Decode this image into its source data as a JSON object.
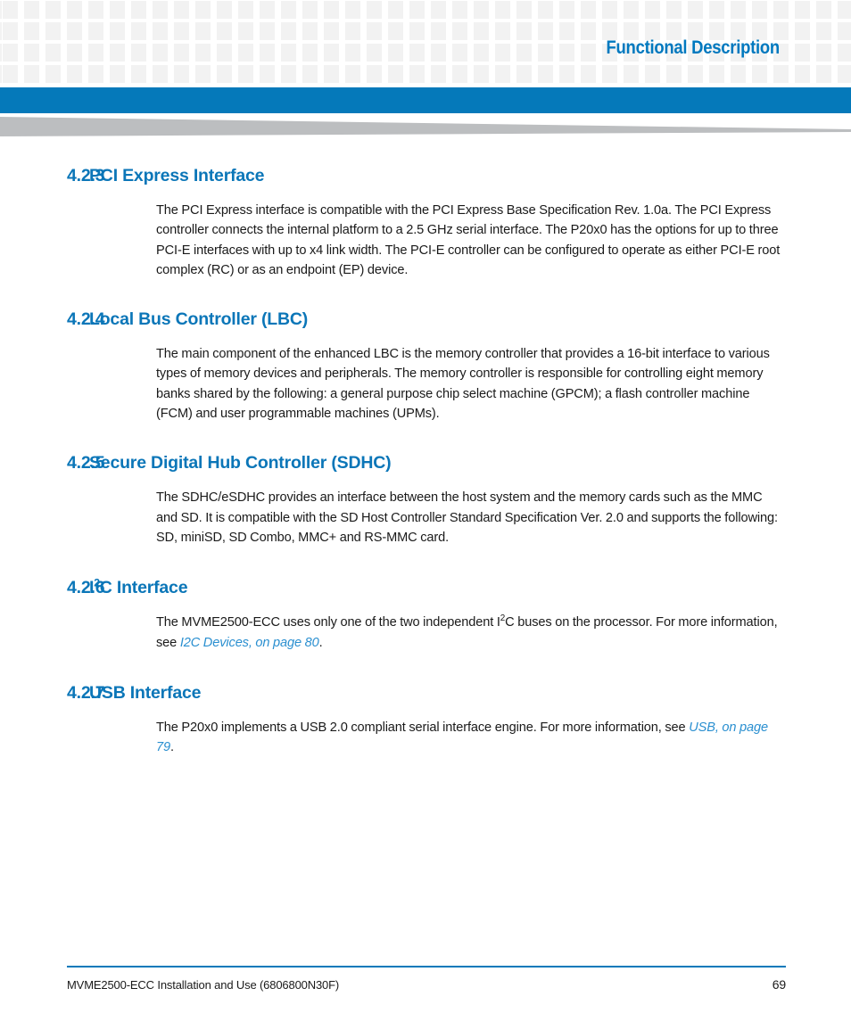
{
  "header": {
    "title": "Functional Description",
    "accent_color": "#0579ba",
    "grid_square_color": "#f2f2f2",
    "wedge_color": "#bcbec0"
  },
  "sections": [
    {
      "number": "4.2.3",
      "title": "PCI Express Interface",
      "paragraph": "The PCI Express interface is compatible with the PCI Express Base Specification Rev. 1.0a. The PCI Express controller connects the internal platform to a 2.5 GHz serial interface. The P20x0 has the options for up to three PCI-E interfaces with up to x4 link width. The PCI-E controller can be configured to operate as either PCI-E root complex (RC) or as an endpoint (EP) device."
    },
    {
      "number": "4.2.4",
      "title": "Local Bus Controller (LBC)",
      "paragraph": "The main component of the enhanced LBC is the memory controller that provides a 16-bit interface to various types of memory devices and peripherals. The memory controller is responsible for controlling eight memory banks shared by the following: a general purpose chip select machine (GPCM); a flash controller machine (FCM) and user programmable machines (UPMs)."
    },
    {
      "number": "4.2.5",
      "title": "Secure Digital Hub Controller (SDHC)",
      "paragraph": "The SDHC/eSDHC provides an interface between the host system and the memory cards such as the MMC and SD. It is compatible with the SD Host Controller Standard Specification Ver. 2.0 and supports the following: SD, miniSD, SD Combo, MMC+ and RS-MMC card."
    },
    {
      "number": "4.2.6",
      "title_pre": "I",
      "title_sup": "2",
      "title_post": "C Interface",
      "para_pre": "The MVME2500-ECC uses only one of the two independent I",
      "para_sup": "2",
      "para_mid": "C buses on the processor. For more information, see ",
      "link": "I2C Devices, on page 80",
      "para_post": "."
    },
    {
      "number": "4.2.7",
      "title": "USB Interface",
      "para_pre": "The P20x0 implements a USB 2.0 compliant serial interface engine. For more information, see ",
      "link": "USB, on page 79",
      "para_post": "."
    }
  ],
  "footer": {
    "document": "MVME2500-ECC Installation and Use (6806800N30F)",
    "page_number": "69"
  }
}
